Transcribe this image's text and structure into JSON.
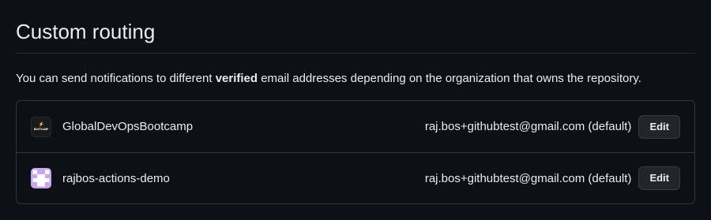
{
  "section": {
    "title": "Custom routing",
    "description_before": "You can send notifications to different ",
    "description_bold": "verified",
    "description_after": " email addresses depending on the organization that owns the repository."
  },
  "organizations": [
    {
      "name": "GlobalDevOpsBootcamp",
      "email": "raj.bos+githubtest@gmail.com (default)",
      "edit_label": "Edit",
      "avatar_icon": "bootcamp-logo-icon",
      "avatar_text": "BOOTCAMP"
    },
    {
      "name": "rajbos-actions-demo",
      "email": "raj.bos+githubtest@gmail.com (default)",
      "edit_label": "Edit",
      "avatar_icon": "identicon-icon"
    }
  ],
  "colors": {
    "background": "#0d1117",
    "border": "#30363d",
    "text": "#e6edf3",
    "button_bg": "#21262d",
    "identicon_bg": "#c9a6ee",
    "identicon_fg": "#ffffff"
  }
}
